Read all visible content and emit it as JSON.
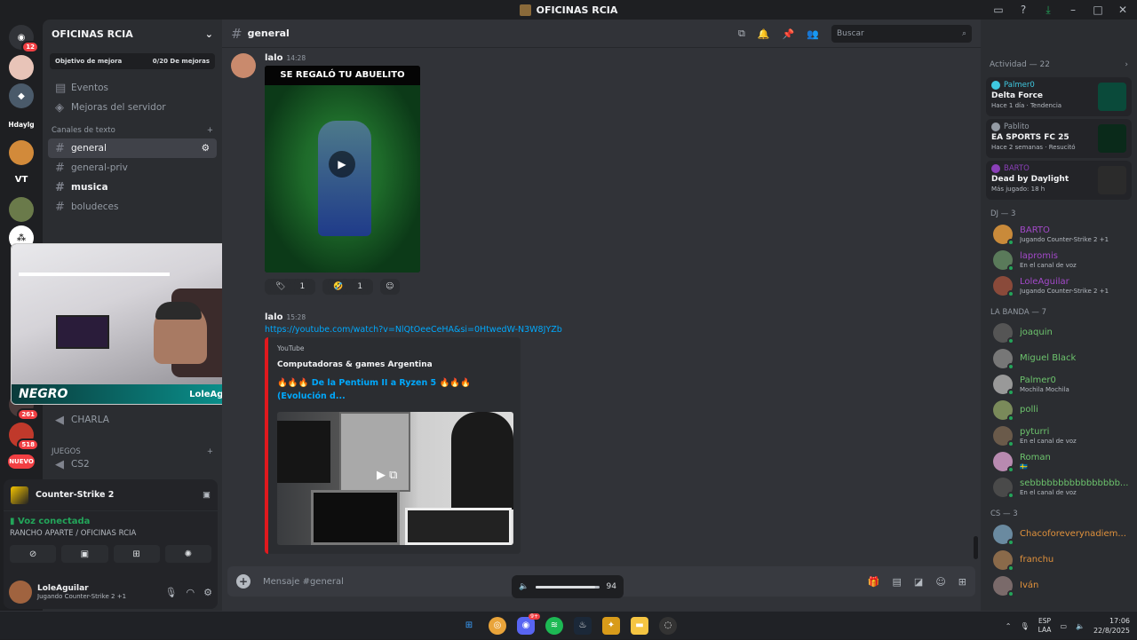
{
  "window": {
    "title": "OFICINAS RCIA"
  },
  "server_rail": {
    "home_badge": "12",
    "label_hdaylg": "Hdaylg",
    "label_vt": "VT",
    "badge_261": "261",
    "badge_518": "518",
    "new_label": "NUEVO"
  },
  "guild": {
    "name": "OFICINAS RCIA",
    "goal_label": "Objetivo de mejora",
    "goal_progress": "0/20 De mejoras",
    "events": "Eventos",
    "boosts": "Mejoras del servidor",
    "text_category": "Canales de texto",
    "channels": [
      {
        "name": "general",
        "state": "active"
      },
      {
        "name": "general-priv",
        "state": "muted"
      },
      {
        "name": "musica",
        "state": "unread"
      },
      {
        "name": "boludeces",
        "state": "muted"
      }
    ],
    "voice_channel_charla": "CHARLA",
    "games_category": "JUEGOS",
    "voice_channel_cs2": "CS2"
  },
  "stream_overlay": {
    "brand": "NEGRO",
    "handle": "LoleAguilar"
  },
  "user_panel": {
    "game": "Counter-Strike 2",
    "voice_status": "Voz conectada",
    "voice_location": "RANCHO APARTE / OFICINAS RCIA",
    "username": "LoleAguilar",
    "user_status": "Jugando Counter-Strike 2 +1"
  },
  "chat": {
    "channel": "general",
    "search_placeholder": "Buscar",
    "messages": [
      {
        "author": "lalo",
        "time": "14:28",
        "video_caption": "SE REGALÓ TU ABUELITO",
        "reactions": [
          {
            "emoji": "🏷",
            "count": "1"
          },
          {
            "emoji": "🤣",
            "count": "1"
          }
        ]
      },
      {
        "author": "lalo",
        "time": "15:28",
        "link": "https://youtube.com/watch?v=NlQtOeeCeHA&si=0HtwedW-N3W8JYZb",
        "embed": {
          "provider": "YouTube",
          "channel": "Computadoras & games Argentina",
          "title": "🔥🔥🔥 De la Pentium II a Ryzen 5 🔥🔥🔥 (Evolución d..."
        }
      }
    ],
    "composer_placeholder": "Mensaje #general",
    "volume_value": "94",
    "volume_level": 0.94
  },
  "activity": {
    "header": "Actividad — 22",
    "items": [
      {
        "user": "Palmer0",
        "game": "Delta Force",
        "meta": "Hace 1 día · Tendencia",
        "color": "#3fc8e0"
      },
      {
        "user": "Pablito",
        "game": "EA SPORTS FC 25",
        "meta": "Hace 2 semanas · Resucitó",
        "color": "#949ba4"
      },
      {
        "user": "BARTO",
        "game": "Dead by Daylight",
        "meta": "Más jugado: 18 h",
        "color": "#8a3fb8"
      }
    ]
  },
  "member_groups": [
    {
      "title": "DJ — 3",
      "members": [
        {
          "name": "BARTO",
          "status": "Jugando Counter-Strike 2 +1",
          "color": "#a349c9"
        },
        {
          "name": "lapromis",
          "status": "En el canal de voz",
          "color": "#a349c9"
        },
        {
          "name": "LoleAguilar",
          "status": "Jugando Counter-Strike 2 +1",
          "color": "#a349c9"
        }
      ]
    },
    {
      "title": "LA BANDA — 7",
      "members": [
        {
          "name": "joaquin",
          "status": "",
          "color": "#6dc46d"
        },
        {
          "name": "Miguel Black",
          "status": "",
          "color": "#6dc46d"
        },
        {
          "name": "Palmer0",
          "status": "Mochila Mochila",
          "color": "#6dc46d"
        },
        {
          "name": "polli",
          "status": "",
          "color": "#6dc46d"
        },
        {
          "name": "pyturri",
          "status": "En el canal de voz",
          "color": "#6dc46d"
        },
        {
          "name": "Roman",
          "status": "🇸🇪",
          "color": "#6dc46d"
        },
        {
          "name": "sebbbbbbbbbbbbbbbb...",
          "status": "En el canal de voz",
          "color": "#6dc46d"
        }
      ]
    },
    {
      "title": "CS — 3",
      "members": [
        {
          "name": "Chacoforeverynadiem...",
          "status": "",
          "color": "#e0913c"
        },
        {
          "name": "franchu",
          "status": "",
          "color": "#e0913c"
        },
        {
          "name": "Iván",
          "status": "",
          "color": "#e0913c"
        }
      ]
    }
  ],
  "taskbar": {
    "lang_top": "ESP",
    "lang_bottom": "LAA",
    "time": "17:06",
    "date": "22/8/2025",
    "discord_badge": "9+"
  }
}
